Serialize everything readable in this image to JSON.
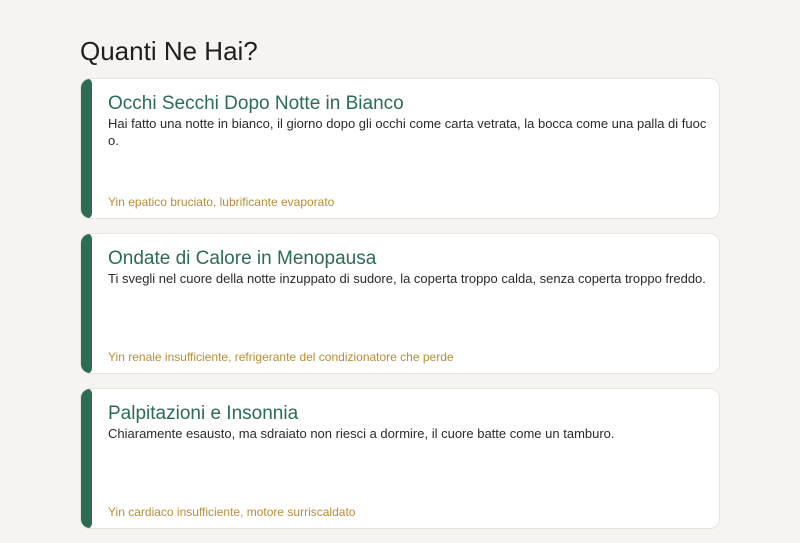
{
  "page": {
    "title": "Quanti Ne Hai?"
  },
  "cards": [
    {
      "title": "Occhi Secchi Dopo Notte in Bianco",
      "description": "Hai fatto una notte in bianco, il giorno dopo gli occhi come carta vetrata, la bocca come una palla di fuoco.",
      "tag": "Yin epatico bruciato, lubrificante evaporato"
    },
    {
      "title": "Ondate di Calore in Menopausa",
      "description": "Ti svegli nel cuore della notte inzuppato di sudore, la coperta troppo calda, senza coperta troppo freddo.",
      "tag": "Yin renale insufficiente, refrigerante del condizionatore che perde"
    },
    {
      "title": "Palpitazioni e Insonnia",
      "description": "Chiaramente esausto, ma sdraiato non riesci a dormire, il cuore batte come un tamburo.",
      "tag": "Yin cardiaco insufficiente, motore surriscaldato"
    }
  ],
  "colors": {
    "background": "#f5f4f0",
    "accent": "#2d6b53",
    "tag": "#b68d3a"
  }
}
